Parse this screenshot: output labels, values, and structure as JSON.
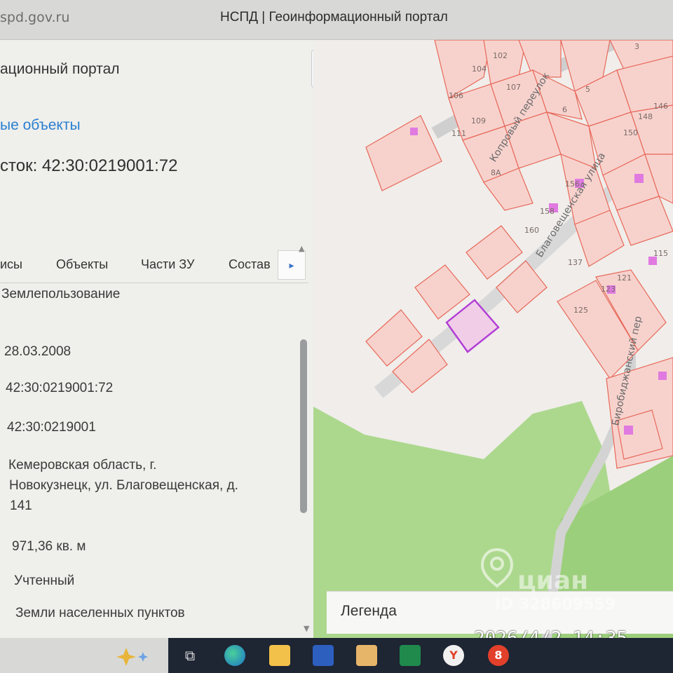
{
  "browser": {
    "url": "spd.gov.ru",
    "tab_title": "НСПД | Геоинформационный портал"
  },
  "panel": {
    "portal_title": "ационный портал",
    "objects_link": "ые объекты",
    "parcel_title": "сток: 42:30:0219001:72",
    "collapse_label": "«",
    "tabs": [
      "исы",
      "Объекты",
      "Части ЗУ",
      "Состав"
    ],
    "tab_more_label": "▸",
    "details": {
      "usage": "Землепользование",
      "date": "28.03.2008",
      "cadastral_number": "42:30:0219001:72",
      "quarter": "42:30:0219001",
      "address_lines": [
        "Кемеровская область, г.",
        "Новокузнецк, ул. Благовещенская, д.",
        "141"
      ],
      "area": "971,36 кв. м",
      "status": "Учтенный",
      "category": "Земли населенных пунктов"
    }
  },
  "map": {
    "streets": [
      "Копровый переулок",
      "Благовещенская улица",
      "Биробиджанский пер"
    ],
    "parcel_numbers": [
      "102",
      "104",
      "107",
      "106",
      "5",
      "6",
      "3",
      "146",
      "148",
      "150",
      "111",
      "109",
      "8А",
      "156",
      "158",
      "160",
      "137",
      "115",
      "121",
      "123",
      "125"
    ],
    "legend_label": "Легенда",
    "colors": {
      "parcel_fill": "#f7d2cd",
      "parcel_stroke": "#e8695a",
      "selected_stroke": "#b13bd6",
      "green_zone": "#a4d583"
    }
  },
  "overlay": {
    "watermark": "циан",
    "watermark_id": "ID 328609559",
    "timestamp": "2026/4/2 14:35"
  },
  "taskbar": {
    "icons": [
      "task-view-icon",
      "edge-icon",
      "file-explorer-icon",
      "word-icon",
      "mail-icon",
      "excel-icon",
      "yandex-browser-icon",
      "badge-app-icon"
    ],
    "badge": "8"
  }
}
